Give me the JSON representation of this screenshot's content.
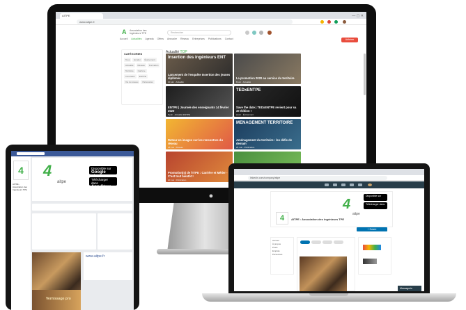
{
  "imac": {
    "browser_tab": "AITPE",
    "url": "www.aitpe.fr",
    "site": {
      "logo_text": "Association des Ingénieurs TPE",
      "search_placeholder": "Rechercher",
      "nav": [
        "Accueil",
        "Actualités",
        "Agenda",
        "Offres",
        "Annuaire",
        "Réseau",
        "Entreprises",
        "Publications",
        "Contact"
      ],
      "cta": "Adhérer",
      "sidebar_title": "CATÉGORIES",
      "sidebar_tags": [
        "Tous",
        "Emploi",
        "Événement",
        "Actualité",
        "Réseau",
        "Formation",
        "Territoire",
        "Carrière",
        "Innovation",
        "ENTPE",
        "Vie du réseau",
        "Partenaires"
      ],
      "main_title": "Actualité",
      "main_title_tag": "TOP",
      "cards": [
        {
          "headline": "Insertion des ingénieurs ENT",
          "caption": "Lancement de l'enquête Insertion des jeunes diplômés",
          "meta": "10 juin · Actualité",
          "colors": [
            "#6a5b4a",
            "#2b2b2b"
          ]
        },
        {
          "headline": "",
          "caption": "La promotion 2020 au service du territoire",
          "meta": "8 juin · Actualité",
          "colors": [
            "#4b4b4b",
            "#8a7a62"
          ]
        },
        {
          "headline": "",
          "caption": "ENTPE | Journée des enseignants 14 février 2020",
          "meta": "5 juin · Actualité ENTPE",
          "colors": [
            "#1e1e1e",
            "#555555"
          ]
        },
        {
          "headline": "TEDxENTPE",
          "caption": "Save the date | TEDxENTPE revient pour sa 3e édition !",
          "meta": "2 juin · Événement",
          "colors": [
            "#2a2a2a",
            "#111111"
          ]
        },
        {
          "headline": "",
          "caption": "Retour en images sur les rencontres du réseau",
          "meta": "28 mai · Réseau",
          "colors": [
            "#f2b632",
            "#e05a47"
          ]
        },
        {
          "headline": "MENAGEMENT TERRITOIRE",
          "caption": "Aménagement du territoire : les défis de demain",
          "meta": "25 mai · Publication",
          "colors": [
            "#1c3d5e",
            "#3a6d8c"
          ]
        },
        {
          "headline": "",
          "caption": "Promotion(s) de l'ITPE : Carrière et Métier - C'est tout bientôt !",
          "meta": "20 mai · Publication",
          "colors": [
            "#b8442f",
            "#e08a3c"
          ]
        },
        {
          "headline": "",
          "caption": "",
          "meta": "",
          "colors": [
            "#4a8f3e",
            "#7bbf5a"
          ]
        }
      ]
    }
  },
  "tablet": {
    "page_name": "AITPE - Association des Ingénieurs TPE",
    "brand": "aitpe",
    "badge_google": {
      "small": "Disponible sur",
      "big": "Google play"
    },
    "badge_apple": {
      "small": "Télécharger dans",
      "big": "App Store"
    },
    "cover_url": "www.aitpe.fr",
    "photo_caption": "Vernissage pro"
  },
  "laptop": {
    "url": "linkedin.com/company/aitpe",
    "brand": "aitpe",
    "company_title": "AITPE : Association des ingénieurs TPE",
    "follow_label": "+ Suivre",
    "side_links": [
      "Accueil",
      "À propos",
      "Posts",
      "Emplois",
      "Personnes"
    ],
    "chat_label": "Messagerie"
  }
}
